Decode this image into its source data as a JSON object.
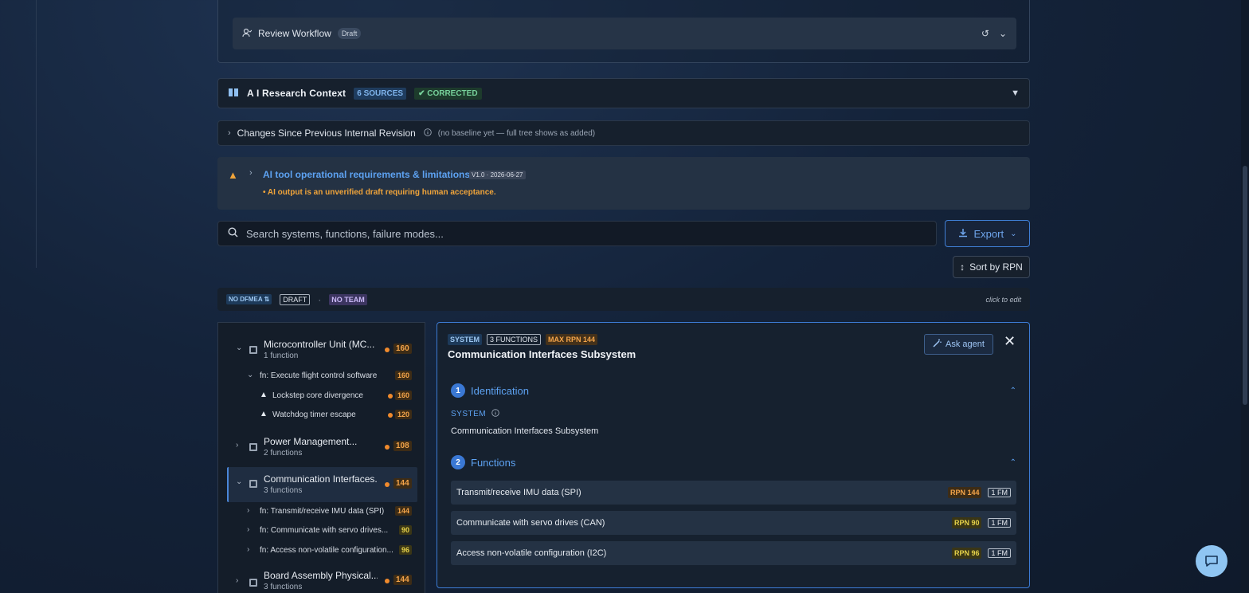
{
  "review": {
    "label": "Review Workflow",
    "badge": "Draft"
  },
  "research": {
    "title": "A I Research Context",
    "sources": "6 SOURCES",
    "status": "✔ CORRECTED"
  },
  "changes": {
    "title": "Changes Since Previous Internal Revision",
    "note": "(no baseline yet — full tree shows as added)"
  },
  "warning": {
    "title": "AI tool operational requirements & limitations",
    "version": "V1.0 · 2026-06-27",
    "bullet": "• AI output is an unverified draft requiring human acceptance."
  },
  "search": {
    "placeholder": "Search systems, functions, failure modes..."
  },
  "toolbar": {
    "export_label": "Export",
    "sort_label": "Sort by RPN"
  },
  "meta": {
    "dfmea": "NO DFMEA ⇅",
    "status": "DRAFT",
    "separator": "·",
    "team": "NO TEAM",
    "edit_hint": "click to edit"
  },
  "tree": {
    "nodes": [
      {
        "name": "Microcontroller Unit (MC...",
        "sub": "1 function",
        "rpn": "160"
      },
      {
        "name": "Power Management...",
        "sub": "2 functions",
        "rpn": "108"
      },
      {
        "name": "Communication Interfaces...",
        "sub": "3 functions",
        "rpn": "144"
      },
      {
        "name": "Board Assembly Physical...",
        "sub": "3 functions",
        "rpn": "144"
      }
    ],
    "mcu_fn": {
      "label": "fn: Execute flight control software",
      "rpn": "160"
    },
    "mcu_fms": [
      {
        "label": "Lockstep core divergence",
        "rpn": "160"
      },
      {
        "label": "Watchdog timer escape",
        "rpn": "120"
      }
    ],
    "comm_fns": [
      {
        "label": "fn: Transmit/receive IMU data (SPI)",
        "rpn": "144"
      },
      {
        "label": "fn: Communicate with servo drives...",
        "rpn": "90"
      },
      {
        "label": "fn: Access non-volatile configuration...",
        "rpn": "96"
      }
    ]
  },
  "detail": {
    "badge_system": "SYSTEM",
    "badge_functions": "3 FUNCTIONS",
    "badge_max": "MAX RPN 144",
    "title": "Communication Interfaces Subsystem",
    "ask_label": "Ask agent",
    "sections": [
      {
        "num": "1",
        "title": "Identification"
      },
      {
        "num": "2",
        "title": "Functions"
      }
    ],
    "system_label": "SYSTEM",
    "system_value": "Communication Interfaces Subsystem",
    "functions": [
      {
        "label": "Transmit/receive IMU data (SPI)",
        "rpn": "RPN 144",
        "fm": "1 FM"
      },
      {
        "label": "Communicate with servo drives (CAN)",
        "rpn": "RPN 90",
        "fm": "1 FM"
      },
      {
        "label": "Access non-volatile configuration (I2C)",
        "rpn": "RPN 96",
        "fm": "1 FM"
      }
    ]
  },
  "colors": {
    "accent": "#3c7bd4",
    "rpn_orange": "#f5a54a",
    "rpn_yellow": "#e6d24a",
    "warning": "#f0a43a"
  },
  "icons": [
    "user-check-icon",
    "reset-icon",
    "chevron-down-icon",
    "book-icon",
    "info-icon",
    "warning-icon",
    "search-icon",
    "download-icon",
    "sort-icon",
    "chip-icon",
    "wand-icon",
    "close-icon",
    "chat-icon"
  ]
}
